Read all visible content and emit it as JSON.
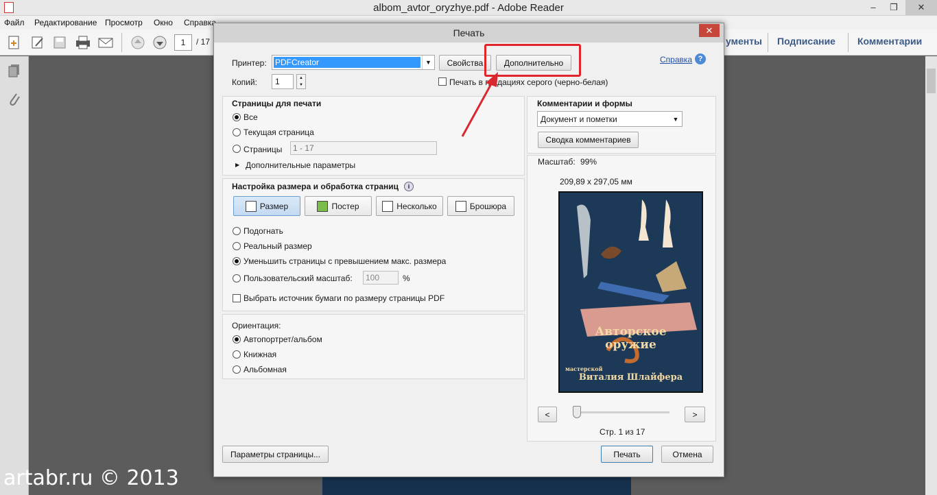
{
  "window": {
    "title": "albom_avtor_oryzhye.pdf - Adobe Reader",
    "minimize": "–",
    "maximize": "❐",
    "close": "✕"
  },
  "menu": [
    "Файл",
    "Редактирование",
    "Просмотр",
    "Окно",
    "Справка"
  ],
  "toolbar": {
    "page_current": "1",
    "page_total": "/ 17",
    "tabs": [
      "ументы",
      "Подписание",
      "Комментарии"
    ]
  },
  "dialog": {
    "title": "Печать",
    "close": "✕",
    "printer_label": "Принтер:",
    "printer_value": "PDFCreator",
    "properties_button": "Свойства",
    "advanced_button": "Дополнительно",
    "help_link": "Справка",
    "copies_label": "Копий:",
    "copies_value": "1",
    "grayscale_label": "Печать в градациях серого (черно-белая)",
    "pages": {
      "heading": "Страницы для печати",
      "all": "Все",
      "current": "Текущая страница",
      "pages": "Страницы",
      "range_placeholder": "1 - 17",
      "more_options": "Дополнительные параметры"
    },
    "sizing": {
      "heading": "Настройка размера и обработка страниц",
      "buttons": [
        "Размер",
        "Постер",
        "Несколько",
        "Брошюра"
      ],
      "fit": "Подогнать",
      "actual": "Реальный размер",
      "shrink": "Уменьшить страницы с превышением макс. размера",
      "custom": "Пользовательский масштаб:",
      "custom_value": "100",
      "percent": "%",
      "paper_source": "Выбрать источник бумаги по размеру страницы PDF"
    },
    "orientation": {
      "heading": "Ориентация:",
      "auto": "Автопортрет/альбом",
      "portrait": "Книжная",
      "landscape": "Альбомная"
    },
    "comments": {
      "heading": "Комментарии и формы",
      "value": "Документ и пометки",
      "summary_button": "Сводка комментариев"
    },
    "preview": {
      "scale_label": "Масштаб:",
      "scale_value": "99%",
      "dimensions": "209,89 x 297,05 мм",
      "title_line1": "Авторское",
      "title_line2": "оружие",
      "subtitle_small": "мастерской",
      "subtitle_big": "Виталия Шлайфера",
      "prev": "<",
      "next": ">",
      "page_indicator": "Стр. 1 из 17"
    },
    "page_setup_button": "Параметры страницы...",
    "print_button": "Печать",
    "cancel_button": "Отмена"
  },
  "watermark": "artabr.ru © 2013",
  "colors": {
    "highlight": "#e0242a",
    "selection": "#3399ff",
    "link": "#1f4fa8",
    "tab_text": "#3b5b86"
  }
}
